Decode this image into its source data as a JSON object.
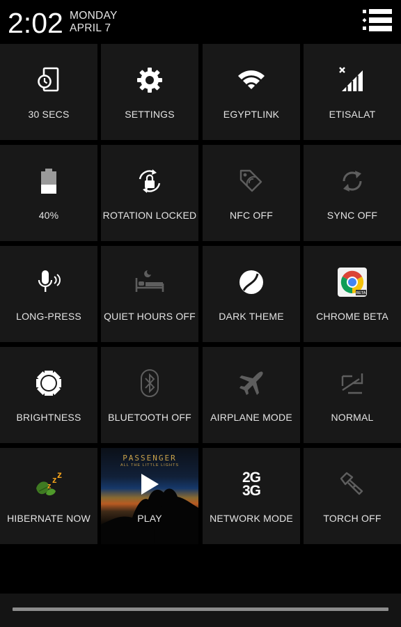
{
  "status": {
    "time": "2:02",
    "day": "MONDAY",
    "date": "APRIL 7"
  },
  "header": {
    "settings_icon": "list-settings-icon"
  },
  "tiles": [
    {
      "label": "30 SECS",
      "icon": "screen-timeout-icon",
      "dim": false
    },
    {
      "label": "SETTINGS",
      "icon": "gear-icon",
      "dim": false
    },
    {
      "label": "EGYPTLINK",
      "icon": "wifi-icon",
      "dim": false
    },
    {
      "label": "ETISALAT",
      "icon": "cell-signal-icon",
      "dim": false
    },
    {
      "label": "40%",
      "icon": "battery-icon",
      "dim": false
    },
    {
      "label": "ROTATION LOCKED",
      "icon": "rotation-lock-icon",
      "dim": false
    },
    {
      "label": "NFC OFF",
      "icon": "nfc-tag-icon",
      "dim": true
    },
    {
      "label": "SYNC OFF",
      "icon": "sync-icon",
      "dim": true
    },
    {
      "label": "LONG-PRESS",
      "icon": "microphone-icon",
      "dim": false
    },
    {
      "label": "QUIET HOURS OFF",
      "icon": "bed-moon-icon",
      "dim": true
    },
    {
      "label": "DARK THEME",
      "icon": "dark-theme-icon",
      "dim": false
    },
    {
      "label": "CHROME BETA",
      "icon": "chrome-beta-icon",
      "dim": false
    },
    {
      "label": "BRIGHTNESS",
      "icon": "sun-icon",
      "dim": false
    },
    {
      "label": "BLUETOOTH OFF",
      "icon": "bluetooth-icon",
      "dim": true
    },
    {
      "label": "AIRPLANE MODE",
      "icon": "airplane-icon",
      "dim": true
    },
    {
      "label": "NORMAL",
      "icon": "network-arrows-icon",
      "dim": true
    },
    {
      "label": "HIBERNATE NOW",
      "icon": "hibernate-leaf-icon",
      "dim": false
    },
    {
      "label": "PLAY",
      "icon": "play-icon",
      "dim": false
    },
    {
      "label": "NETWORK MODE",
      "icon": "network-mode-icon",
      "dim": false
    },
    {
      "label": "TORCH OFF",
      "icon": "flashlight-icon",
      "dim": true
    }
  ],
  "album_art": {
    "artist": "PASSENGER",
    "album": "ALL THE LITTLE LIGHTS"
  },
  "network_mode": {
    "top": "2G",
    "bottom": "3G"
  },
  "chrome_badge": "BETA",
  "colors": {
    "tile_bg": "#181818",
    "page_bg": "#000000",
    "icon_active": "#ffffff",
    "icon_dim": "#5e5e5e",
    "handle": "#8c8c8c"
  }
}
